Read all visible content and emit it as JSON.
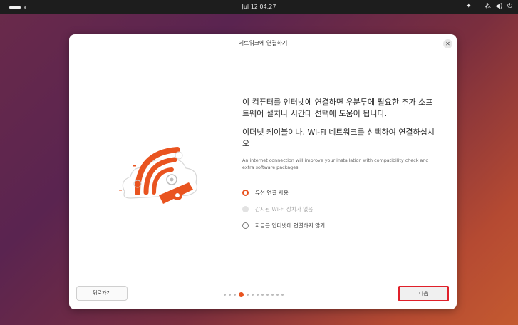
{
  "topbar": {
    "clock": "Jul 12  04:27",
    "icons": [
      "activities-pill-icon",
      "accessibility-icon",
      "network-icon",
      "volume-icon",
      "power-icon"
    ]
  },
  "dialog": {
    "title": "네트워크에 연결하기",
    "headline": "이 컴퓨터를 인터넷에 연결하면 우분투에 필요한 추가 소프트웨어 설치나 시간대 선택에 도움이 됩니다.",
    "subheadline": "이더넷 케이블이나, Wi-Fi 네트워크를 선택하여 연결하십시오",
    "description": "An internet connection will improve your installation with compatibility check and extra software packages.",
    "options": [
      {
        "label": "유선 연결 사용",
        "state": "checked"
      },
      {
        "label": "감지된 Wi-Fi 장치가 없음",
        "state": "disabled"
      },
      {
        "label": "지금은 인터넷에 연결하지 않기",
        "state": "unchecked"
      }
    ],
    "back_label": "뒤로가기",
    "next_label": "다음",
    "pager": {
      "total": 12,
      "active": 4
    }
  },
  "colors": {
    "accent": "#e95420",
    "highlight_border": "#e0202a",
    "topbar": "#1d1d1d"
  }
}
